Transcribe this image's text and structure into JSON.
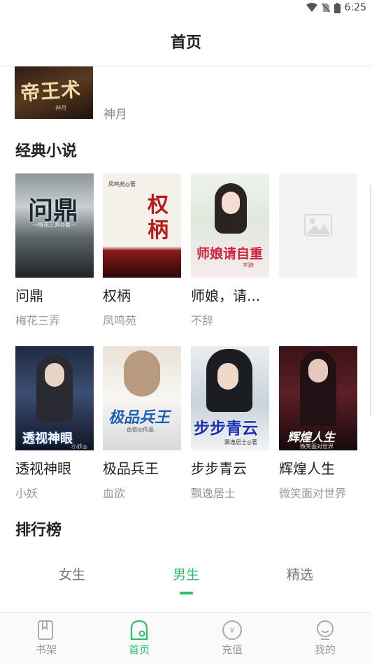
{
  "status_bar": {
    "time": "6:25"
  },
  "header": {
    "title": "首页"
  },
  "top_book": {
    "cover_text": "帝王术",
    "cover_sub": "神月",
    "author": "神月"
  },
  "sections": {
    "classic_title": "经典小说",
    "ranking_title": "排行榜"
  },
  "classic_books": [
    {
      "title": "问鼎",
      "author": "梅花三弄",
      "cover_text": "问鼎",
      "cover_sub": "—梅花三弄◎著—"
    },
    {
      "title": "权柄",
      "author": "凤鸣苑",
      "cover_text": "权柄",
      "cover_sub": "凤鸣苑◎著"
    },
    {
      "title": "师娘，请...",
      "author": "不辞",
      "cover_text": "师娘请自重",
      "cover_sub": "不辞"
    },
    {
      "title": "透视神眼",
      "author": "小妖",
      "cover_text": "透视神眼",
      "cover_sub": "小妖◎"
    },
    {
      "title": "极品兵王",
      "author": "血欲",
      "cover_text": "极品兵王",
      "cover_sub": "血欲◎作品"
    },
    {
      "title": "步步青云",
      "author": "飘逸居士",
      "cover_text": "步步青云",
      "cover_sub": "飘逸居士◎著"
    },
    {
      "title": "辉煌人生",
      "author": "微笑面对世界",
      "cover_text": "辉煌人生",
      "cover_sub": "微笑面对世界"
    }
  ],
  "ranking_tabs": [
    "女生",
    "男生",
    "精选"
  ],
  "active_ranking_tab": "男生",
  "bottom_nav": [
    {
      "label": "书架",
      "icon": "bookshelf-icon"
    },
    {
      "label": "首页",
      "icon": "home-icon"
    },
    {
      "label": "充值",
      "icon": "recharge-icon"
    },
    {
      "label": "我的",
      "icon": "profile-icon"
    }
  ],
  "active_nav": "首页",
  "colors": {
    "accent": "#2bbf6c",
    "text_primary": "#222222",
    "text_secondary": "#999999"
  }
}
